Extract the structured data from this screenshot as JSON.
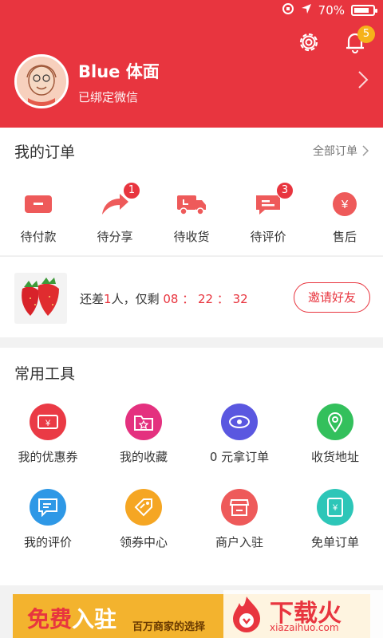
{
  "status": {
    "battery": "70%"
  },
  "header": {
    "user_name": "Blue 体面",
    "user_sub": "已绑定微信",
    "notifications": "5"
  },
  "orders": {
    "title": "我的订单",
    "all_label": "全部订单",
    "items": [
      {
        "label": "待付款",
        "badge": ""
      },
      {
        "label": "待分享",
        "badge": "1"
      },
      {
        "label": "待收货",
        "badge": ""
      },
      {
        "label": "待评价",
        "badge": "3"
      },
      {
        "label": "售后",
        "badge": ""
      }
    ]
  },
  "group": {
    "text_prefix": "还差",
    "count": "1",
    "text_mid": "人，仅剩",
    "timer": "08 ： 22 ： 32",
    "invite": "邀请好友"
  },
  "tools": {
    "title": "常用工具",
    "items": [
      {
        "label": "我的优惠券",
        "color": "#ea3a45"
      },
      {
        "label": "我的收藏",
        "color": "#e4317f"
      },
      {
        "label": "0 元拿订单",
        "color": "#5a57e0"
      },
      {
        "label": "收货地址",
        "color": "#33c05c"
      },
      {
        "label": "我的评价",
        "color": "#2e98e6"
      },
      {
        "label": "领券中心",
        "color": "#f5a623"
      },
      {
        "label": "商户入驻",
        "color": "#ee5a5a"
      },
      {
        "label": "免单订单",
        "color": "#2dc6b8"
      }
    ]
  },
  "banner": {
    "main_free": "免费",
    "main_rest": "入驻",
    "sub": "百万商家的选择"
  },
  "watermark": {
    "main": "下载火",
    "sub": "xiazaihuo.com"
  },
  "colors": {
    "brand": "#e8353f",
    "badge_yellow": "#f6b21a"
  }
}
